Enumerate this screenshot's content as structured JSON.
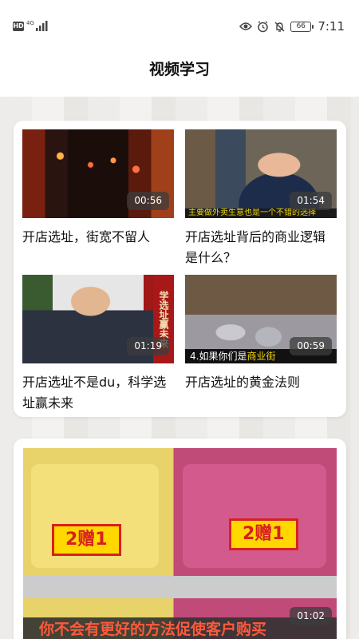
{
  "status_bar": {
    "hd": "HD",
    "network": "4G",
    "battery": "66",
    "time": "7:11",
    "icons": [
      "eye-icon",
      "alarm-icon",
      "mute-icon"
    ]
  },
  "header": {
    "title": "视频学习"
  },
  "videos": [
    {
      "title": "开店选址，街宽不留人",
      "duration": "00:56",
      "thumb_caption": ""
    },
    {
      "title": "开店选址背后的商业逻辑是什么？",
      "duration": "01:54",
      "thumb_caption": "主要做外卖生意也是一个不错的选择"
    },
    {
      "title": "开店选址不是du，科学选址赢未来",
      "duration": "01:19",
      "thumb_caption": "学选址赢未来"
    },
    {
      "title": "开店选址的黄金法则",
      "duration": "00:59",
      "thumb_caption_prefix": "4.如果你们是",
      "thumb_caption_highlight": "商业街"
    }
  ],
  "featured": {
    "duration": "01:02",
    "promo_left": "2赠1",
    "promo_right": "2赠1",
    "subtitle": "你不会有更好的方法促使客户购买"
  }
}
